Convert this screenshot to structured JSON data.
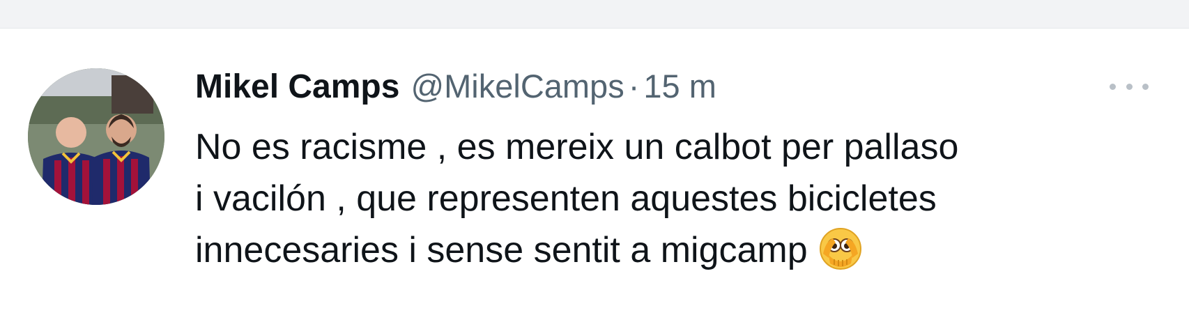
{
  "tweet": {
    "author_name": "Mikel Camps",
    "handle": "@MikelCamps",
    "separator": "·",
    "timestamp": "15 m",
    "text_lines": [
      "No es racisme , es mereix un calbot per pallaso",
      "i vacilón , que representen aquestes bicicletes",
      "innecesaries  i sense sentit a migcamp"
    ],
    "emoji": "face-with-hand-over-eyes-emoji"
  },
  "colors": {
    "text": "#0f1419",
    "secondary": "#536471",
    "background": "#ffffff"
  },
  "icons": {
    "more": "more-options-icon",
    "avatar": "profile-avatar"
  }
}
